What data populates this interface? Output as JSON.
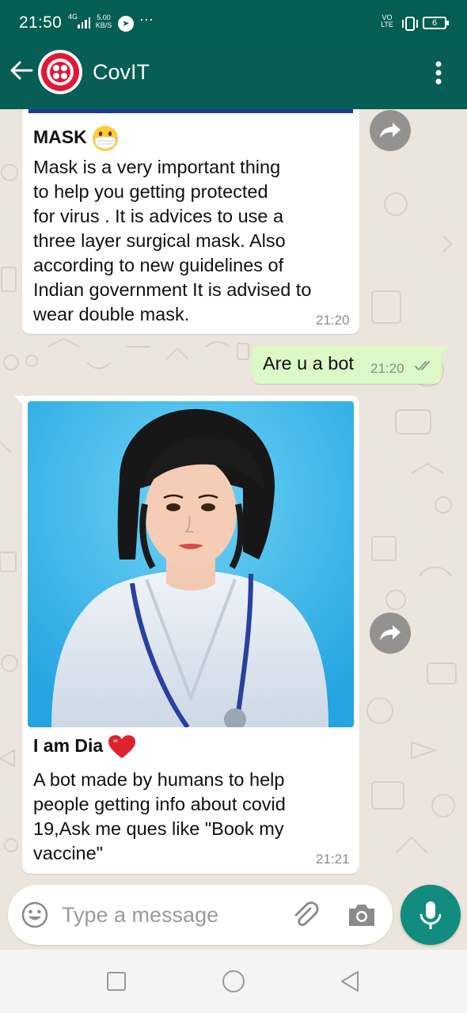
{
  "status_bar": {
    "time": "21:50",
    "network_type": "4G",
    "speed_value": "5.00",
    "speed_unit": "KB/S",
    "overflow": "···",
    "volte": "VO LTE",
    "battery": "6"
  },
  "header": {
    "title": "CovIT",
    "colors": {
      "bar": "#075e54",
      "status_bar": "#055e52",
      "avatar_logo": "#e31837"
    }
  },
  "messages": [
    {
      "direction": "incoming",
      "title": "MASK",
      "title_emoji": "face-with-medical-mask",
      "body": "Mask is a very important thing\nto help you getting protected\nfor virus . It is advices to use a\nthree layer surgical mask. Also\naccording to new guidelines of\nIndian government It is advised to\nwear double mask.",
      "time": "21:20"
    },
    {
      "direction": "outgoing",
      "text": "Are u a bot",
      "time": "21:20",
      "status": "read-double-tick"
    },
    {
      "direction": "incoming",
      "has_image": true,
      "image_subject": "animated-doctor-portrait",
      "title": "I am Dia",
      "title_emoji": "red-heart",
      "body": "A bot made by humans to help\npeople getting info about covid\n19,Ask me ques like \"Book my\nvaccine\"",
      "time": "21:21"
    }
  ],
  "composer": {
    "placeholder": "Type a message",
    "value": ""
  },
  "icons": {
    "back": "arrow-left-icon",
    "menu": "more-vertical-icon",
    "forward": "forward-icon",
    "emoji": "emoji-icon",
    "attach": "paperclip-icon",
    "camera": "camera-icon",
    "mic": "microphone-icon"
  },
  "theme": {
    "chat_bg": "#ece5dd",
    "incoming_bubble": "#ffffff",
    "outgoing_bubble": "#dcf8c6",
    "mic_button": "#128c7e"
  }
}
